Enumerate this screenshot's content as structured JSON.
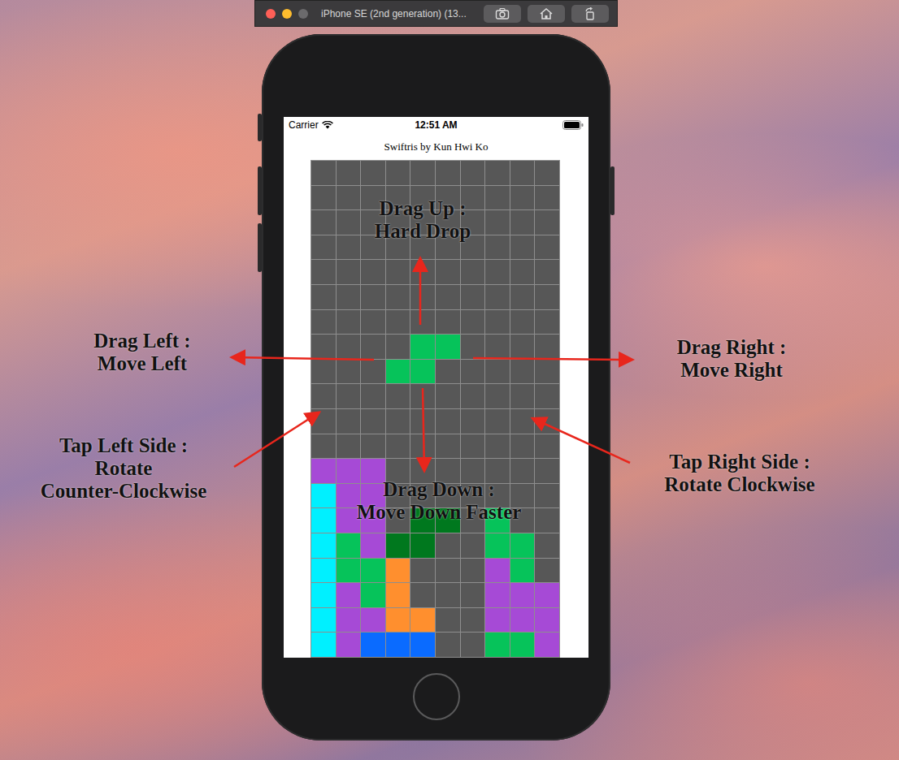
{
  "simulator": {
    "title": "iPhone SE (2nd generation) (13..."
  },
  "status_bar": {
    "carrier": "Carrier",
    "time": "12:51 AM"
  },
  "app": {
    "title": "Swiftris by Kun Hwi Ko"
  },
  "board": {
    "rows": [
      [
        null,
        null,
        null,
        null,
        null,
        null,
        null,
        null,
        null,
        null
      ],
      [
        null,
        null,
        null,
        null,
        null,
        null,
        null,
        null,
        null,
        null
      ],
      [
        null,
        null,
        null,
        null,
        null,
        null,
        null,
        null,
        null,
        null
      ],
      [
        null,
        null,
        null,
        null,
        null,
        null,
        null,
        null,
        null,
        null
      ],
      [
        null,
        null,
        null,
        null,
        null,
        null,
        null,
        null,
        null,
        null
      ],
      [
        null,
        null,
        null,
        null,
        null,
        null,
        null,
        null,
        null,
        null
      ],
      [
        null,
        null,
        null,
        null,
        null,
        null,
        null,
        null,
        null,
        null
      ],
      [
        null,
        null,
        null,
        null,
        "#06c35a",
        "#06c35a",
        null,
        null,
        null,
        null
      ],
      [
        null,
        null,
        null,
        "#06c35a",
        "#06c35a",
        null,
        null,
        null,
        null,
        null
      ],
      [
        null,
        null,
        null,
        null,
        null,
        null,
        null,
        null,
        null,
        null
      ],
      [
        null,
        null,
        null,
        null,
        null,
        null,
        null,
        null,
        null,
        null
      ],
      [
        null,
        null,
        null,
        null,
        null,
        null,
        null,
        null,
        null,
        null
      ],
      [
        "#a64ad6",
        "#a64ad6",
        "#a64ad6",
        null,
        null,
        null,
        null,
        null,
        null,
        null
      ],
      [
        "#00f0ff",
        "#a64ad6",
        "#a64ad6",
        null,
        null,
        null,
        null,
        null,
        null,
        null
      ],
      [
        "#00f0ff",
        "#a64ad6",
        "#a64ad6",
        null,
        "#00781e",
        "#00781e",
        null,
        "#06c35a",
        null,
        null
      ],
      [
        "#00f0ff",
        "#06c35a",
        "#a64ad6",
        "#00781e",
        "#00781e",
        null,
        null,
        "#06c35a",
        "#06c35a",
        null
      ],
      [
        "#00f0ff",
        "#06c35a",
        "#06c35a",
        "#ff8f2e",
        null,
        null,
        null,
        "#a64ad6",
        "#06c35a",
        null
      ],
      [
        "#00f0ff",
        "#a64ad6",
        "#06c35a",
        "#ff8f2e",
        null,
        null,
        null,
        "#a64ad6",
        "#a64ad6",
        "#a64ad6"
      ],
      [
        "#00f0ff",
        "#a64ad6",
        "#a64ad6",
        "#ff8f2e",
        "#ff8f2e",
        null,
        null,
        "#a64ad6",
        "#a64ad6",
        "#a64ad6"
      ],
      [
        "#00f0ff",
        "#a64ad6",
        "#0a6bff",
        "#0a6bff",
        "#0a6bff",
        null,
        null,
        "#06c35a",
        "#06c35a",
        "#a64ad6"
      ]
    ]
  },
  "annotations": [
    {
      "lines": [
        "Drag Up :",
        "Hard Drop"
      ]
    },
    {
      "lines": [
        "Drag Left :",
        "Move Left"
      ]
    },
    {
      "lines": [
        "Drag Right :",
        "Move Right"
      ]
    },
    {
      "lines": [
        "Tap Left Side :",
        "Rotate",
        "Counter-Clockwise"
      ]
    },
    {
      "lines": [
        "Tap Right Side :",
        "Rotate Clockwise"
      ]
    },
    {
      "lines": [
        "Drag Down :",
        "Move Down Faster"
      ]
    }
  ]
}
